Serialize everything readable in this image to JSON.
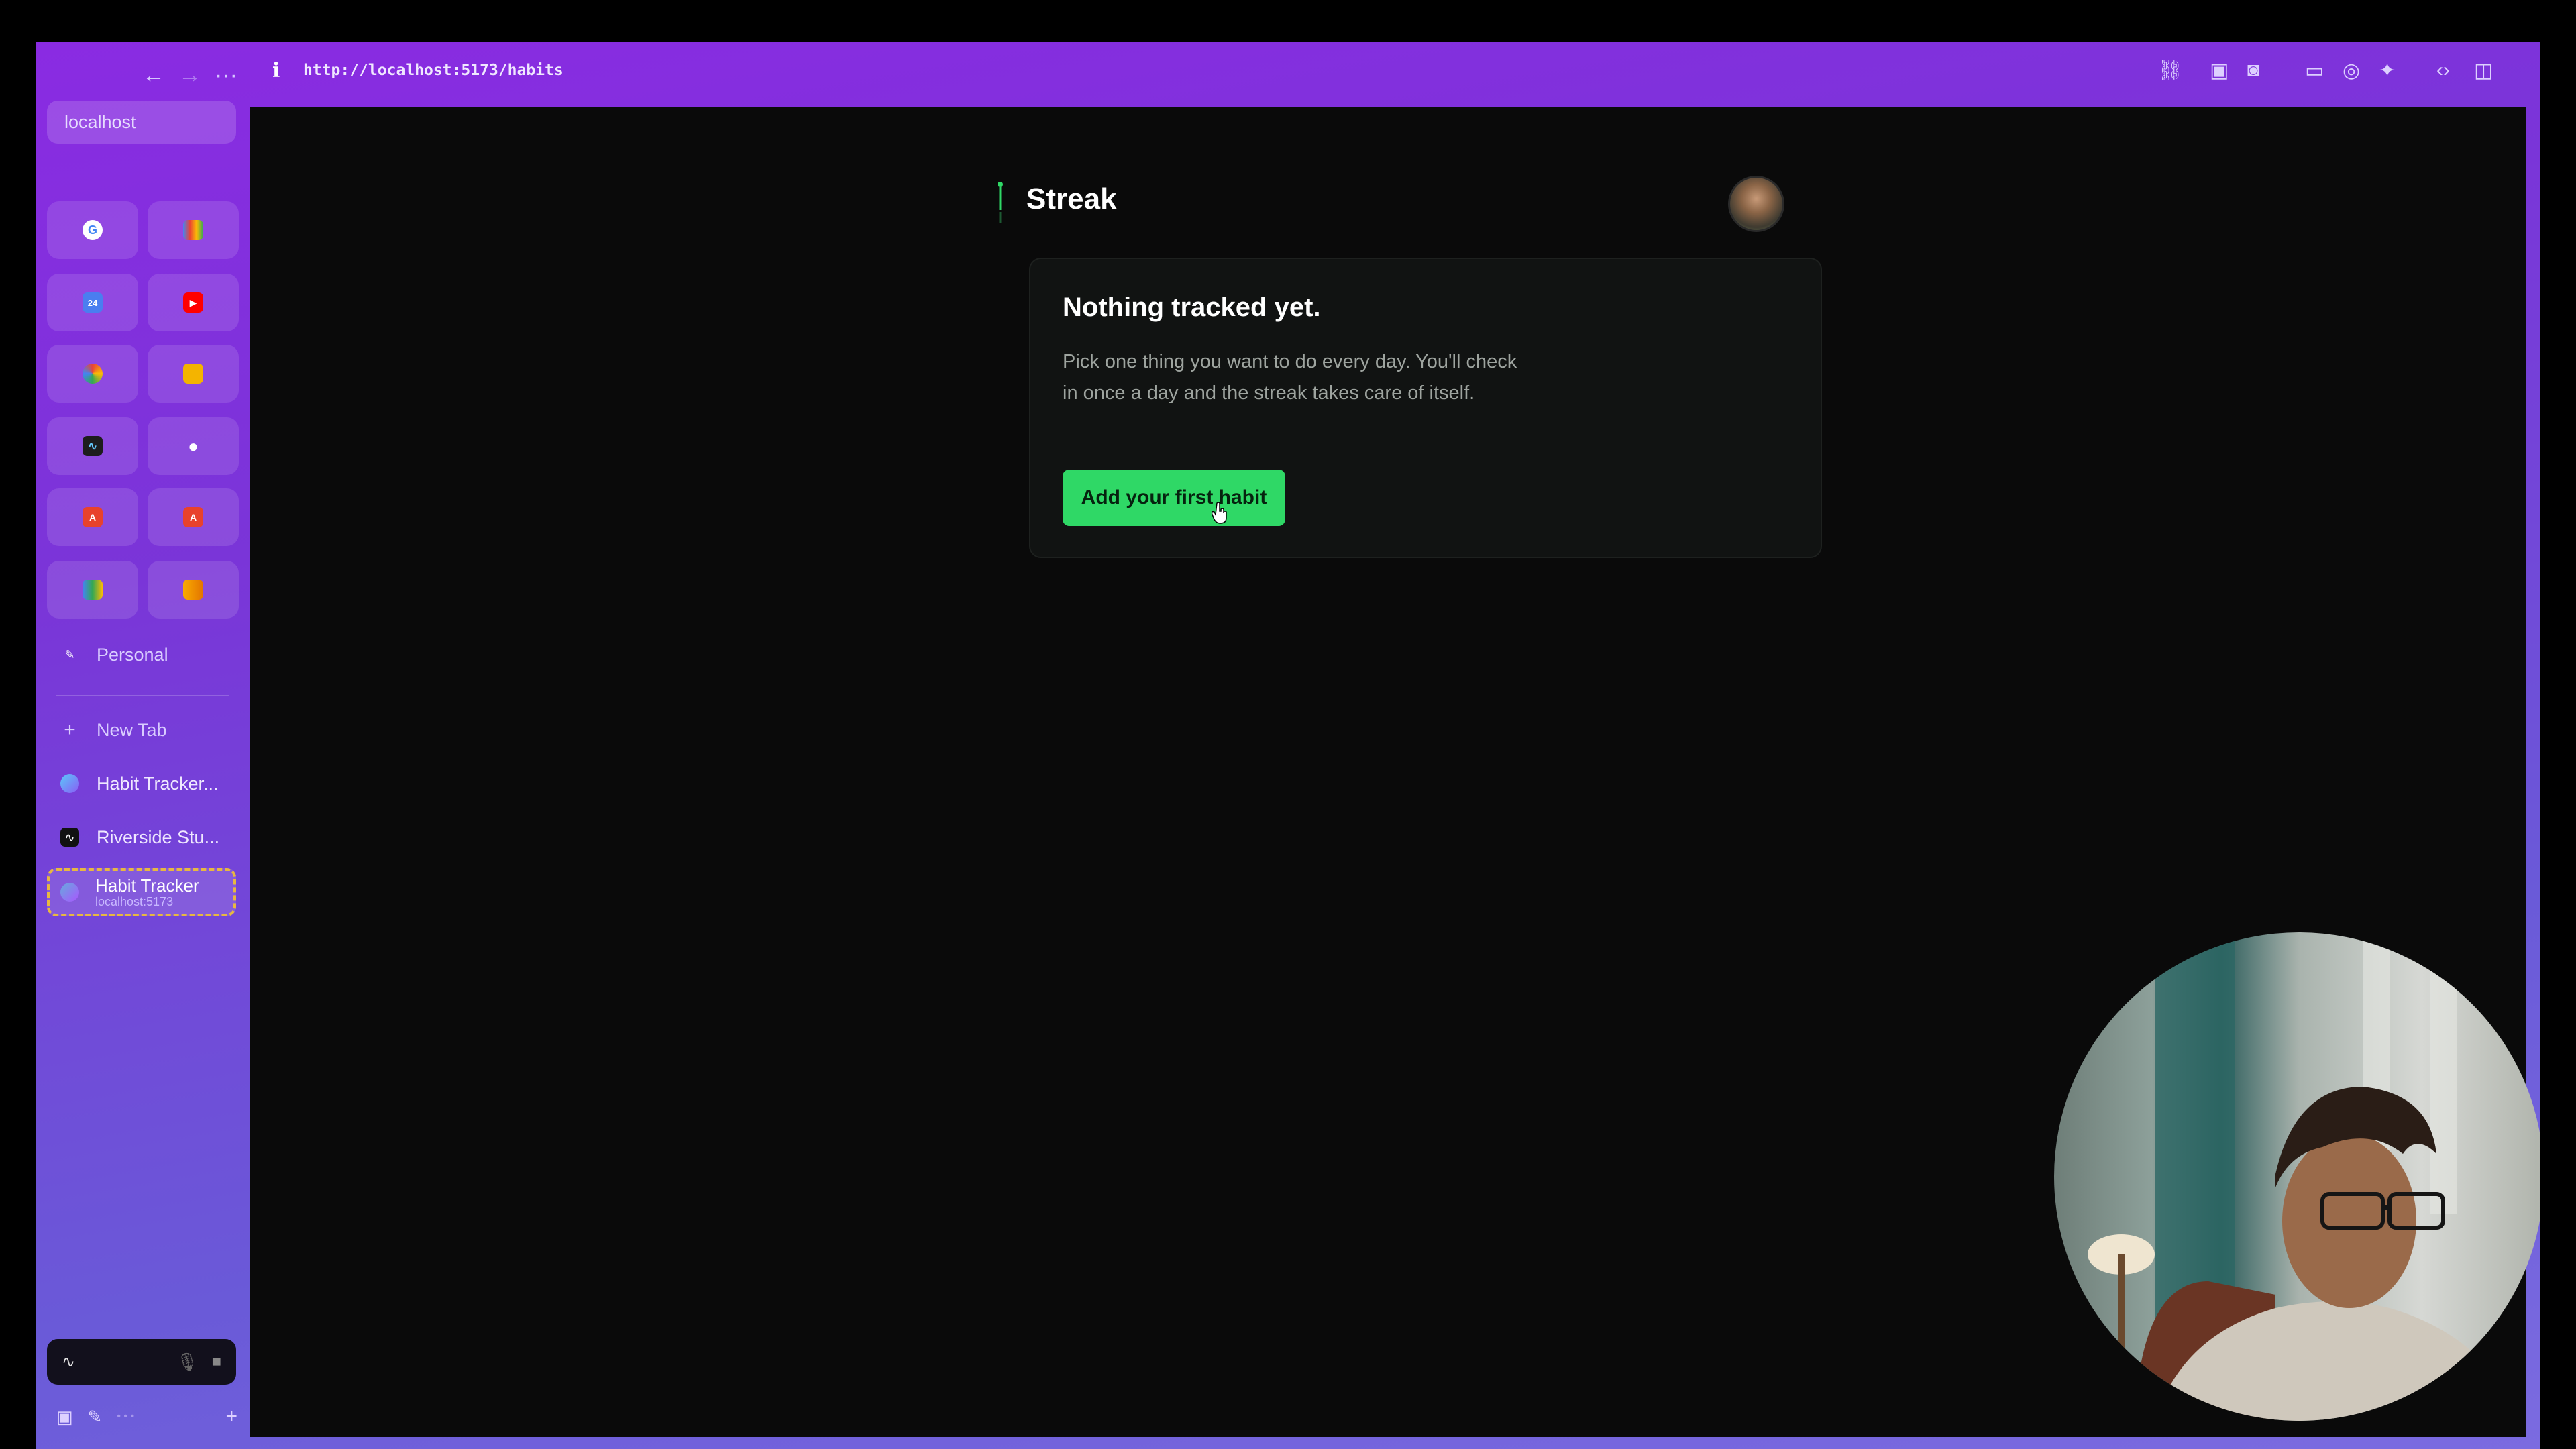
{
  "browser": {
    "url": "http://localhost:5173/habits",
    "sidebar_url": "localhost",
    "nav": {
      "back": "←",
      "forward": "→",
      "more": "···"
    },
    "pinned_icons": [
      "google-icon",
      "gmail-icon",
      "calendar-icon",
      "youtube-icon",
      "google-photos-icon",
      "slides-icon",
      "activity-icon",
      "github-icon",
      "pdf-icon",
      "pdf-icon",
      "analytics-icon",
      "analytics-icon"
    ],
    "space_label": "Personal",
    "new_tab_label": "New Tab",
    "tabs": [
      {
        "title": "Habit Tracker..."
      },
      {
        "title": "Riverside Stu..."
      }
    ],
    "active_tab": {
      "title": "Habit Tracker",
      "subtitle": "localhost:5173"
    }
  },
  "app": {
    "title": "Streak",
    "empty_state": {
      "heading": "Nothing tracked yet.",
      "body": "Pick one thing you want to do every day. You'll check in once a day and the streak takes care of itself.",
      "cta_label": "Add your first habit"
    }
  },
  "colors": {
    "accent": "#2fd866",
    "frame_purple": "#8a2be2",
    "page_bg": "#0a0a0a"
  }
}
